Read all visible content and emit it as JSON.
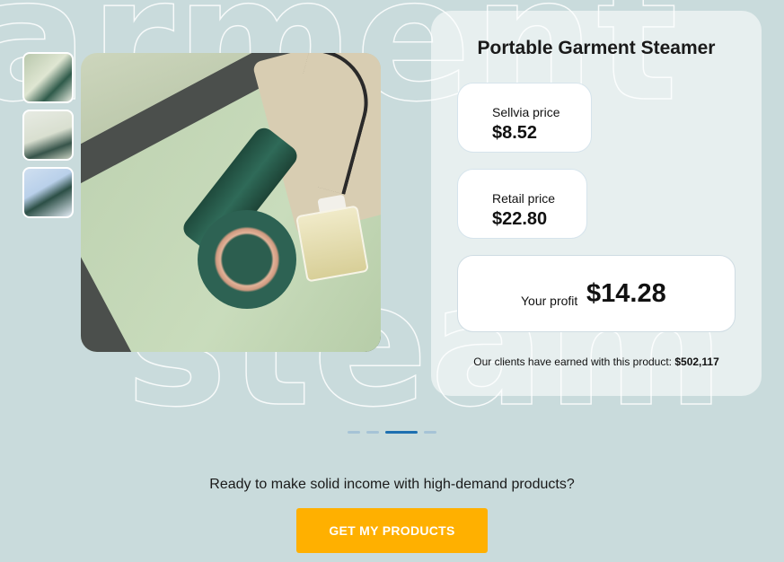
{
  "background_words": {
    "top": "arment",
    "bottom": "steam"
  },
  "product": {
    "title": "Portable Garment Steamer",
    "sellvia_label": "Sellvia price",
    "sellvia_value": "$8.52",
    "retail_label": "Retail price",
    "retail_value": "$22.80",
    "profit_label": "Your profit",
    "profit_value": "$14.28",
    "earned_text": "Our clients have earned with this product: ",
    "earned_value": "$502,117"
  },
  "carousel": {
    "dots": 4,
    "active_index": 2
  },
  "cta": {
    "text": "Ready to make solid income with high-demand products?",
    "button_label": "GET MY PRODUCTS"
  },
  "colors": {
    "background": "#c9dbdc",
    "button": "#ffb000",
    "active_dot": "#1d6fb1"
  }
}
